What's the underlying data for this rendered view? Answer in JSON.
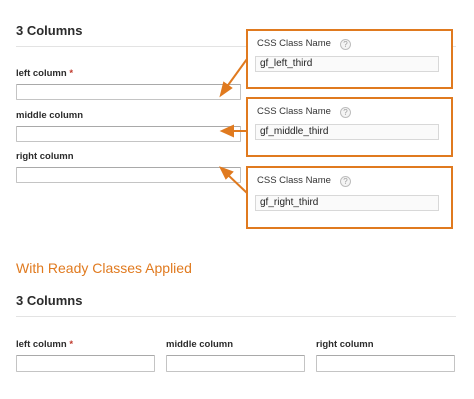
{
  "section_top": {
    "title": "3 Columns",
    "fields": [
      {
        "label": "left column",
        "required_mark": "*"
      },
      {
        "label": "middle column"
      },
      {
        "label": "right column"
      }
    ]
  },
  "callouts": [
    {
      "title": "CSS Class Name",
      "help_icon": "?",
      "value": "gf_left_third"
    },
    {
      "title": "CSS Class Name",
      "help_icon": "?",
      "value": "gf_middle_third"
    },
    {
      "title": "CSS Class Name",
      "help_icon": "?",
      "value": "gf_right_third"
    }
  ],
  "ready_heading": "With Ready Classes Applied",
  "section_bottom": {
    "title": "3 Columns",
    "fields": [
      {
        "label": "left column",
        "required_mark": "*"
      },
      {
        "label": "middle column"
      },
      {
        "label": "right column"
      }
    ]
  },
  "colors": {
    "accent": "#e07a1f",
    "required": "#c0392b"
  }
}
